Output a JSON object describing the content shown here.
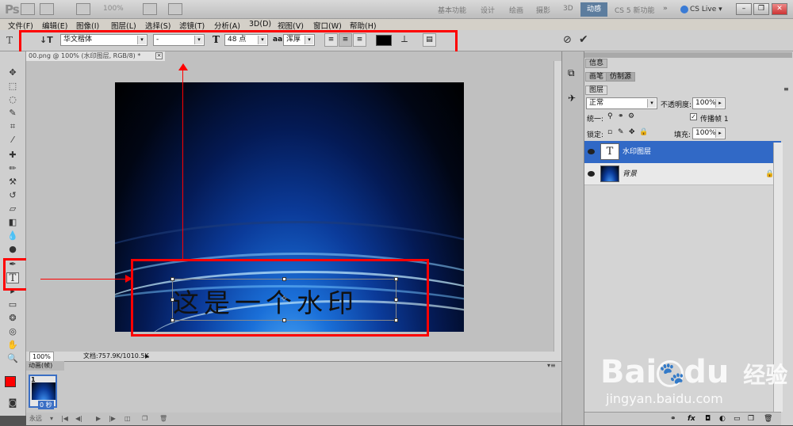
{
  "title_bar": {
    "logo": "Ps",
    "zoom": "100%",
    "workspaces": [
      "基本功能",
      "设计",
      "绘画",
      "摄影",
      "3D"
    ],
    "active_workspace": "动感",
    "cs5_new": "CS 5 新功能",
    "cs_live": "CS Live"
  },
  "menu": [
    "文件(F)",
    "编辑(E)",
    "图像(I)",
    "图层(L)",
    "选择(S)",
    "滤镜(T)",
    "分析(A)",
    "3D(D)",
    "视图(V)",
    "窗口(W)",
    "帮助(H)"
  ],
  "options": {
    "font_family": "华文楷体",
    "font_style": "-",
    "font_size": "48 点",
    "antialias_label": "aa",
    "antialias": "浑厚",
    "text_color": "#000000"
  },
  "document": {
    "tab_label": "00.png @ 100% (水印图层, RGB/8) *",
    "watermark_text": "这是一个水印",
    "zoom": "100%",
    "doc_info": "文档:757.9K/1010.5K"
  },
  "animation": {
    "tab_label": "动画(帧)",
    "frame_number": "1",
    "frame_time": "0 秒",
    "loop": "永远"
  },
  "panels": {
    "info_tab": "信息",
    "brush_tab": "画笔",
    "clone_tab": "仿制源",
    "layers_tab": "图层",
    "blend_mode": "正常",
    "opacity_label": "不透明度:",
    "opacity": "100%",
    "unify_label": "统一:",
    "propagate_label": "传播帧 1",
    "lock_label": "锁定:",
    "fill_label": "填充:",
    "fill": "100%",
    "layers": [
      {
        "name": "水印图层",
        "selected": true
      },
      {
        "name": "背景",
        "selected": false
      }
    ]
  },
  "watermark_site": {
    "logo": "Bai",
    "logo_mid": "du",
    "logo_cn": "经验",
    "url": "jingyan.baidu.com"
  },
  "colors": {
    "highlight": "#ff0000",
    "layer_selected": "#3169c6",
    "foreground": "#ff0000",
    "background": "#ffffff"
  }
}
